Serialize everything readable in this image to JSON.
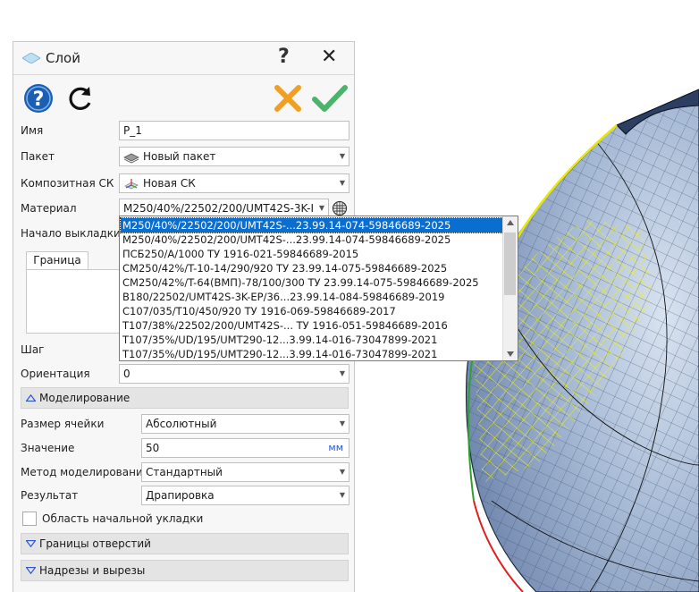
{
  "panel": {
    "title": "Слой",
    "help_symbol": "?",
    "close_symbol": "✕"
  },
  "fields": {
    "name_label": "Имя",
    "name_value": "P_1",
    "package_label": "Пакет",
    "package_value": "Новый пакет",
    "composite_label": "Композитная СК",
    "composite_value": "Новая СК",
    "material_label": "Материал",
    "material_value": "M250/40%/22502/200/UMT42S-3K-I",
    "start_label": "Начало выкладки",
    "step_label": "Шаг",
    "orientation_label": "Ориентация",
    "orientation_value": "0"
  },
  "tabs": {
    "border_tab": "Граница"
  },
  "modeling": {
    "section_label": "Моделирование",
    "cell_size_label": "Размер ячейки",
    "cell_size_value": "Абсолютный",
    "value_label": "Значение",
    "value_value": "50",
    "value_unit": "мм",
    "method_label": "Метод моделирования",
    "method_value": "Стандартный",
    "result_label": "Результат",
    "result_value": "Драпировка",
    "initial_area_label": "Область начальной укладки"
  },
  "sections": {
    "holes": "Границы отверстий",
    "cuts": "Надрезы и вырезы"
  },
  "dropdown": {
    "items": [
      "M250/40%/22502/200/UMT42S-...23.99.14-074-59846689-2025",
      "M250/40%/22502/200/UMT42S-...23.99.14-074-59846689-2025",
      "ПСБ250/А/1000 ТУ 1916-021-59846689-2015",
      "CM250/42%/T-10-14/290/920 ТУ 23.99.14-075-59846689-2025",
      "CM250/42%/T-64(ВМП)-78/100/300 ТУ 23.99.14-075-59846689-2025",
      "B180/22502/UMT42S-3K-EP/36...23.99.14-084-59846689-2019",
      "C107/035/T10/450/920 ТУ 1916-069-59846689-2017",
      "T107/38%/22502/200/UMT42S-... ТУ 1916-051-59846689-2016",
      "T107/35%/UD/195/UMT290-12...3.99.14-016-73047899-2021",
      "T107/35%/UD/195/UMT290-12...3.99.14-016-73047899-2021"
    ]
  },
  "colors": {
    "accent_blue": "#0a6ed1",
    "cancel_orange": "#f0a020",
    "ok_green": "#49b46a",
    "help_blue": "#1a5fb4"
  },
  "icons": [
    "diamond-icon",
    "help-icon",
    "refresh-icon",
    "cancel-icon",
    "ok-icon",
    "package-icon",
    "csys-icon",
    "texture-icon",
    "chevron-down-icon",
    "triangle-up-icon",
    "triangle-down-icon"
  ]
}
